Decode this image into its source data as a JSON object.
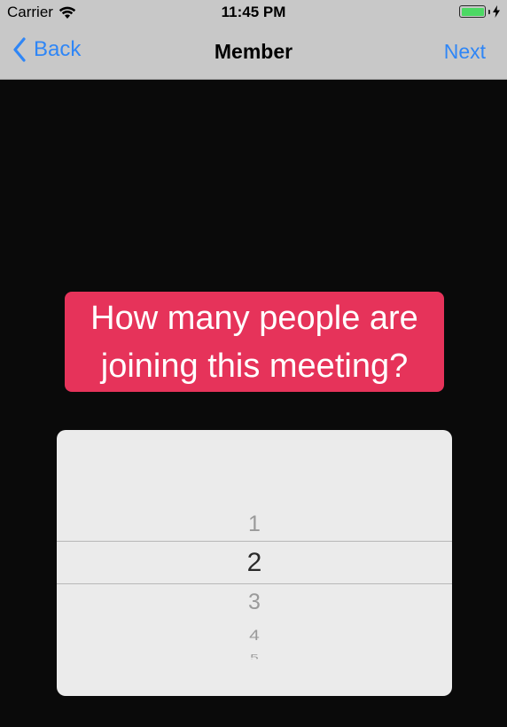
{
  "status_bar": {
    "carrier": "Carrier",
    "time": "11:45 PM",
    "battery_level": 1.0
  },
  "nav": {
    "back_label": "Back",
    "title": "Member",
    "next_label": "Next"
  },
  "question": "How many people are joining this meeting?",
  "picker": {
    "items": [
      "1",
      "2",
      "3",
      "4",
      "5"
    ],
    "selected": "2"
  },
  "colors": {
    "accent": "#2f86f6",
    "question_bg": "#e6335a",
    "battery": "#4cd964"
  }
}
